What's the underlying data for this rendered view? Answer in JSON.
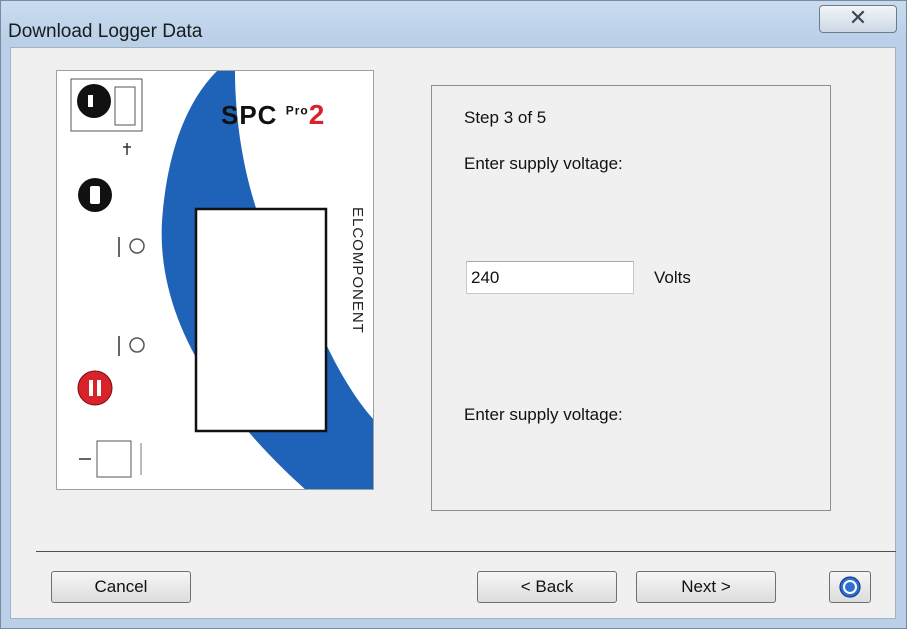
{
  "window": {
    "title": "Download Logger Data",
    "close_glyph": "✕"
  },
  "device": {
    "brand": "SPC",
    "model_sup": "Pro",
    "model_num": "2",
    "vendor_vertical": "ELCOMPONENT",
    "icons": [
      "start-stop-button-icon",
      "usb-icon",
      "record-button-icon",
      "led-indicator-icon",
      "led-indicator-icon",
      "stop-button-icon",
      "pc-connection-port-icon"
    ]
  },
  "wizard": {
    "step": "Step 3 of 5",
    "prompt": "Enter supply voltage:",
    "voltage_value": "240",
    "unit": "Volts",
    "prompt_secondary": "Enter supply voltage:"
  },
  "buttons": {
    "cancel": "Cancel",
    "back": "< Back",
    "next": "Next >",
    "help_icon": "help-icon"
  },
  "colors": {
    "titlebar": "#b9d0e8",
    "device_blue": "#1e63b8",
    "stop_red": "#d8232a",
    "brand_red": "#d8232a"
  }
}
